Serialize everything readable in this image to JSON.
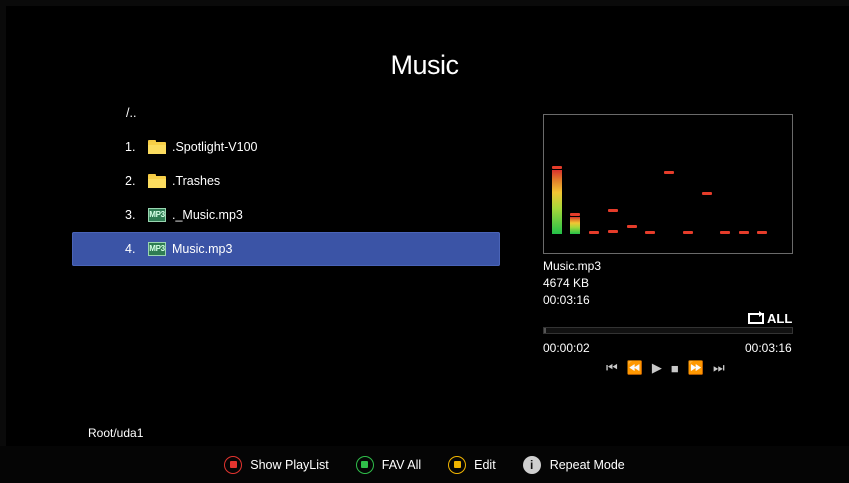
{
  "header": {
    "title": "Music"
  },
  "file_list": {
    "parent_label": "/..",
    "items": [
      {
        "index": "1.",
        "name": ".Spotlight-V100",
        "icon": "folder-icon"
      },
      {
        "index": "2.",
        "name": ".Trashes",
        "icon": "folder-icon"
      },
      {
        "index": "3.",
        "name": "._Music.mp3",
        "icon": "mp3-icon",
        "icon_text": "MP3"
      },
      {
        "index": "4.",
        "name": "Music.mp3",
        "icon": "mp3-icon",
        "icon_text": "MP3",
        "selected": true
      }
    ]
  },
  "player": {
    "file_name": "Music.mp3",
    "file_size": "4674 KB",
    "duration": "00:03:16",
    "repeat_label": "ALL",
    "current_time": "00:00:02",
    "total_time": "00:03:16",
    "progress": 0.01,
    "controls": [
      "previous-icon",
      "rewind-icon",
      "play-icon",
      "stop-icon",
      "fast-forward-icon",
      "next-icon"
    ]
  },
  "status": {
    "path": "Root/uda1"
  },
  "bottom_bar": {
    "hints": [
      {
        "label": "Show PlayList",
        "color": "#e3342f"
      },
      {
        "label": "FAV All",
        "color": "#2fbf4a"
      },
      {
        "label": "Edit",
        "color": "#f0b400"
      },
      {
        "label": "Repeat Mode",
        "icon": "info-icon"
      }
    ]
  },
  "colors": {
    "selected_row": "#3b54a6",
    "background": "#000000"
  }
}
